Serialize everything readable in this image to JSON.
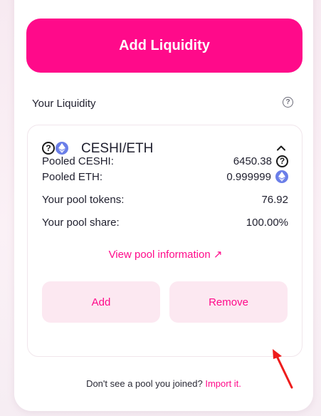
{
  "main": {
    "add_liquidity_label": "Add Liquidity",
    "your_liquidity_label": "Your Liquidity",
    "help_icon": "question-circle-icon"
  },
  "pool": {
    "pair": "CESHI/ETH",
    "token0_icon": "question-circle-icon",
    "token1_icon": "eth-icon",
    "expanded": true,
    "rows": [
      {
        "label": "Pooled CESHI:",
        "value": "6450.38",
        "icon": "question-circle-icon"
      },
      {
        "label": "Pooled ETH:",
        "value": "0.999999",
        "icon": "eth-icon"
      },
      {
        "label": "Your pool tokens:",
        "value": "76.92"
      },
      {
        "label": "Your pool share:",
        "value": "100.00%"
      }
    ],
    "view_link": "View pool information ↗",
    "add_button": "Add",
    "remove_button": "Remove"
  },
  "footer": {
    "text": "Don't see a pool you joined? ",
    "link": "Import it."
  },
  "colors": {
    "accent": "#ff0a8a",
    "soft_button": "#fce8f1",
    "eth": "#6a7ee8",
    "annotation_arrow": "#ee1c1c"
  }
}
